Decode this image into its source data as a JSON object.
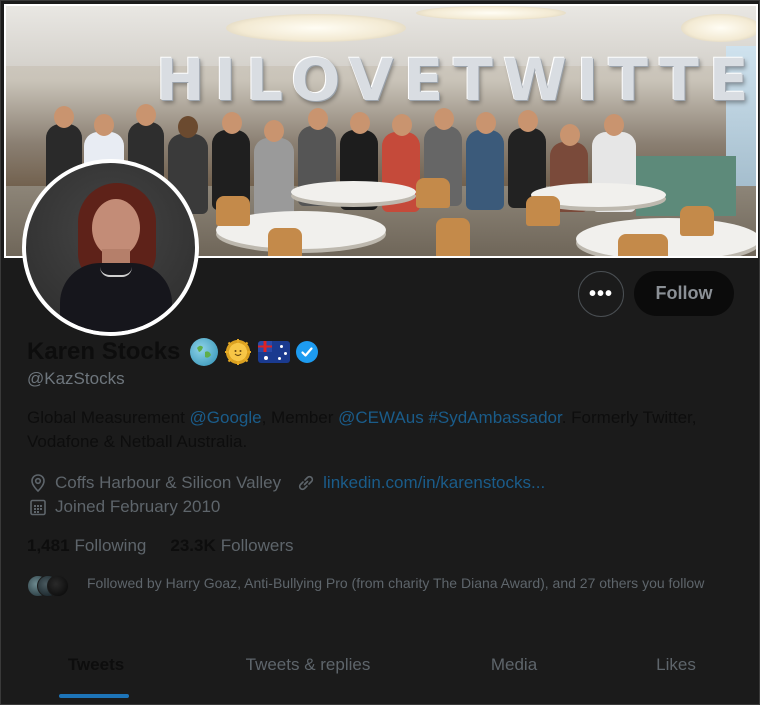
{
  "profile": {
    "display_name": "Karen Stocks",
    "handle": "@KazStocks",
    "bio": {
      "part1": "Global Measurement ",
      "mention_google": "@Google",
      "part2": ", Member ",
      "mention_cew": "@CEWAus",
      "part3": " ",
      "hashtag": "#SydAmbassador",
      "part4": ". Formerly Twitter, Vodafone & Netball Australia."
    },
    "location": "Coffs Harbour & Silicon Valley",
    "website": "linkedin.com/in/karenstocks...",
    "joined": "Joined February 2010",
    "emojis": [
      "globe-emoji",
      "sun-emoji",
      "australia-flag-emoji"
    ],
    "verified": true
  },
  "banner": {
    "balloon_text": "HILOVETWITTER"
  },
  "actions": {
    "more_label": "•••",
    "follow_label": "Follow"
  },
  "stats": {
    "following_count": "1,481",
    "following_label": "Following",
    "followers_count": "23.3K",
    "followers_label": "Followers"
  },
  "followed_by": {
    "text": "Followed by Harry Goaz, Anti-Bullying Pro (from charity The Diana Award), and 27 others you follow"
  },
  "tabs": [
    {
      "label": "Tweets",
      "active": true
    },
    {
      "label": "Tweets & replies",
      "active": false
    },
    {
      "label": "Media",
      "active": false
    },
    {
      "label": "Likes",
      "active": false
    }
  ],
  "colors": {
    "accent": "#1d9bf0",
    "link": "#1a5c8a",
    "background": "#1b1b1b"
  }
}
